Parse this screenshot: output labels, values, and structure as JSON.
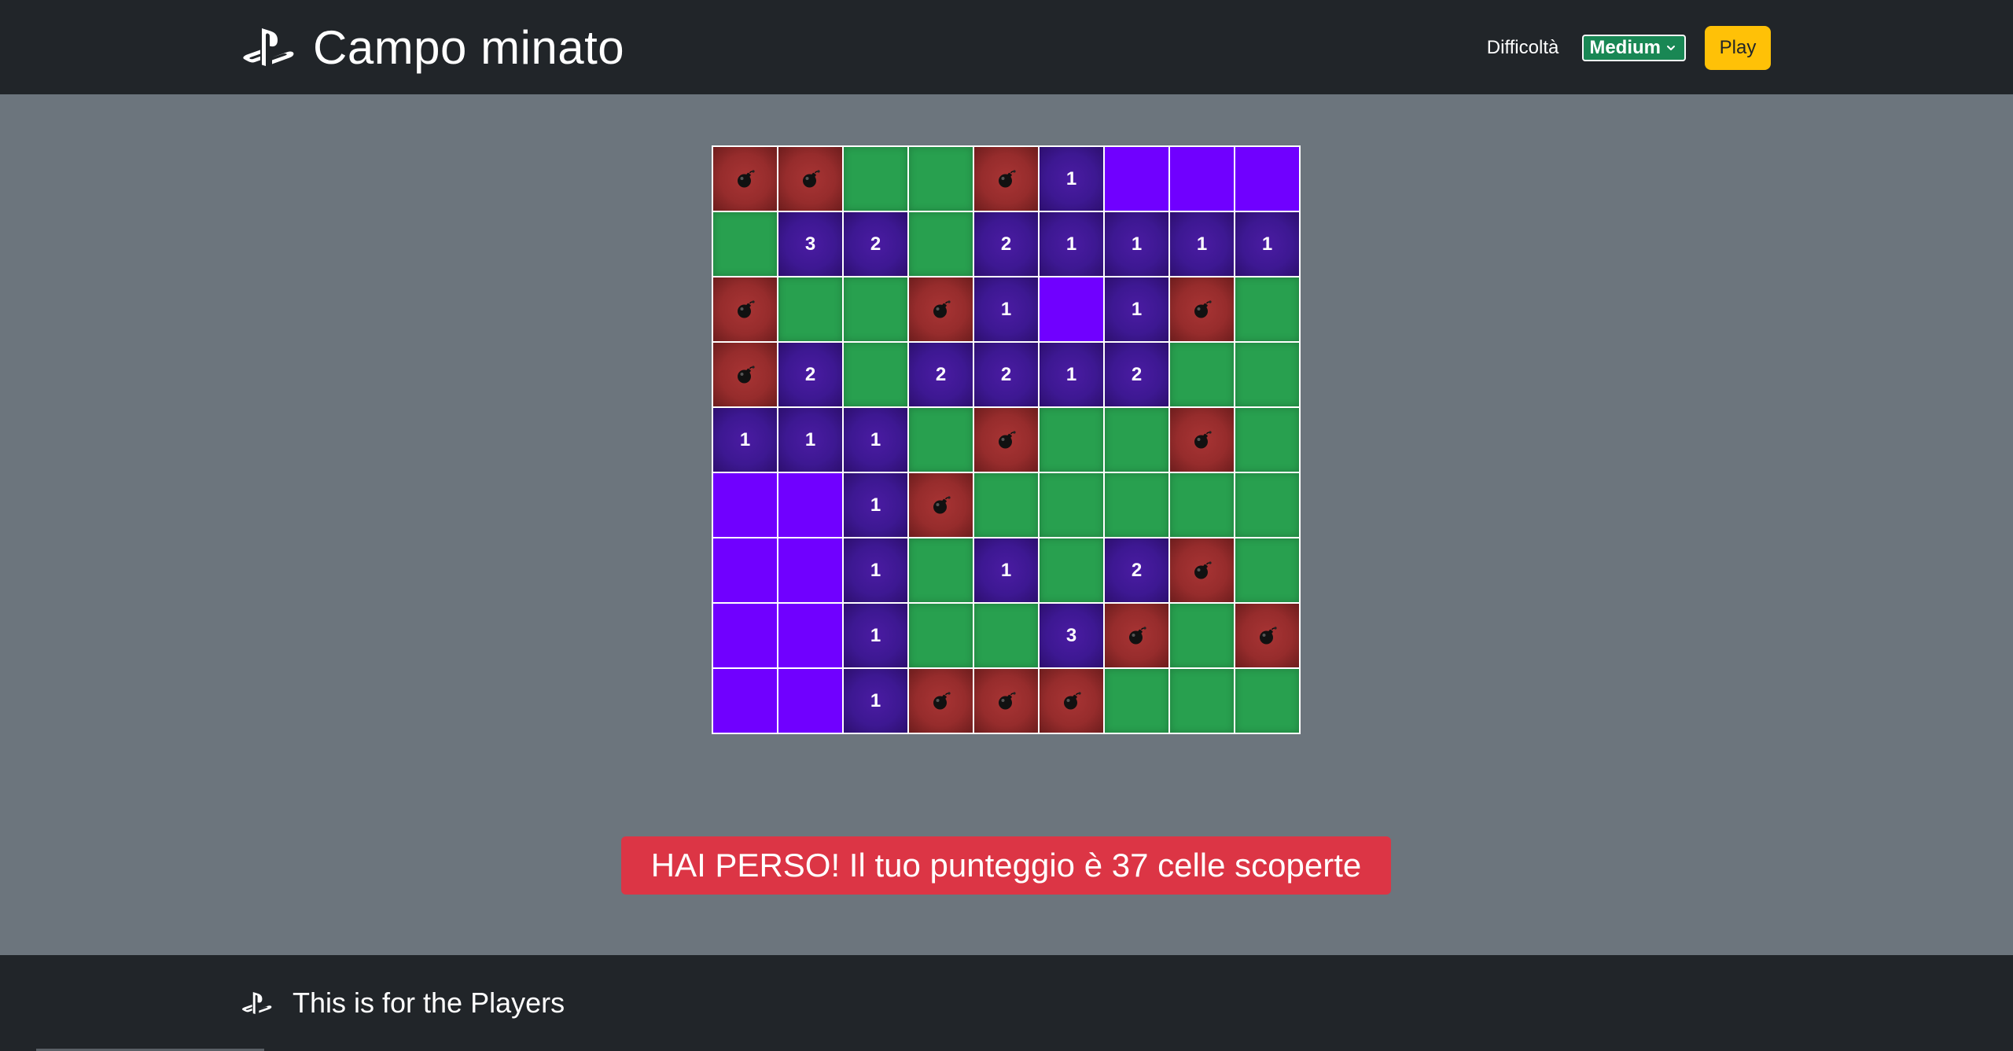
{
  "header": {
    "title": "Campo minato",
    "logo_icon": "playstation-logo-icon",
    "difficulty_label": "Difficoltà",
    "difficulty_value": "Medium",
    "play_label": "Play"
  },
  "board": {
    "rows": 9,
    "cols": 9,
    "cells": [
      [
        "B",
        "B",
        "S",
        "S",
        "B",
        "1",
        "E",
        "E",
        "E"
      ],
      [
        "S",
        "3",
        "2",
        "S",
        "2",
        "1",
        "1",
        "1",
        "1"
      ],
      [
        "B",
        "S",
        "S",
        "B",
        "1",
        "E",
        "1",
        "B",
        "S"
      ],
      [
        "B",
        "2",
        "S",
        "2",
        "2",
        "1",
        "2",
        "S",
        "S"
      ],
      [
        "1",
        "1",
        "1",
        "S",
        "B",
        "S",
        "S",
        "B",
        "S"
      ],
      [
        "E",
        "E",
        "1",
        "B",
        "S",
        "S",
        "S",
        "S",
        "S"
      ],
      [
        "E",
        "E",
        "1",
        "S",
        "1",
        "S",
        "2",
        "B",
        "S"
      ],
      [
        "E",
        "E",
        "1",
        "S",
        "S",
        "3",
        "B",
        "S",
        "B"
      ],
      [
        "E",
        "E",
        "1",
        "B",
        "B",
        "B",
        "S",
        "S",
        "S"
      ]
    ],
    "legend": {
      "B": "bomb",
      "S": "safe",
      "E": "empty",
      "number": "revealed-number"
    },
    "colors": {
      "bomb": "#962c2c",
      "safe": "#28a04f",
      "number": "#3d1892",
      "empty": "#7000ff",
      "border": "#ffffff"
    }
  },
  "result": {
    "message": "HAI PERSO! Il tuo punteggio è 37 celle scoperte",
    "color": "#dc3545"
  },
  "footer": {
    "logo_icon": "playstation-logo-icon",
    "text": "This is for the Players"
  },
  "theme": {
    "header_bg": "#212529",
    "page_bg": "#6c757d",
    "select_bg": "#198754",
    "play_bg": "#ffc107"
  }
}
